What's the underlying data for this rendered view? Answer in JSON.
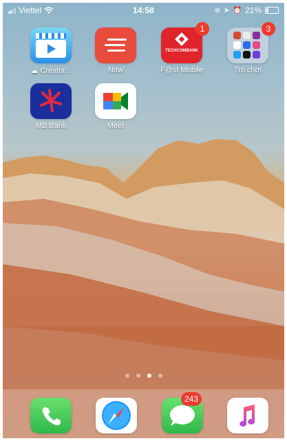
{
  "status": {
    "carrier": "Viettel",
    "time": "14:58",
    "battery": "21%"
  },
  "apps": [
    {
      "label": "Creator...",
      "icon": "clapper-play-icon",
      "badge": null
    },
    {
      "label": "Now",
      "icon": "now-lines-icon",
      "badge": null
    },
    {
      "label": "F@st Mobile",
      "icon": "techcombank-icon",
      "brand_text": "TECHCOMBANK",
      "badge": "1"
    },
    {
      "label": "Trò chơi",
      "icon": "games-folder-icon",
      "badge": "3"
    },
    {
      "label": "MB Bank",
      "icon": "mb-bank-icon",
      "badge": null
    },
    {
      "label": "Meet",
      "icon": "meet-camera-icon",
      "badge": null
    }
  ],
  "page_dots": {
    "count": 4,
    "active": 3
  },
  "dock": [
    {
      "name": "Phone",
      "icon": "phone-icon",
      "badge": null
    },
    {
      "name": "Safari",
      "icon": "compass-icon",
      "badge": null
    },
    {
      "name": "Messages",
      "icon": "message-bubble-icon",
      "badge": "243"
    },
    {
      "name": "Music",
      "icon": "music-note-icon",
      "badge": null
    }
  ],
  "colors": {
    "badge": "#ee3b2f",
    "now_red": "#e94b3c",
    "techcom_red": "#e0242b",
    "mb_blue": "#1a2f9c",
    "phone_green": "#34c759",
    "messages_green": "#34c759"
  }
}
